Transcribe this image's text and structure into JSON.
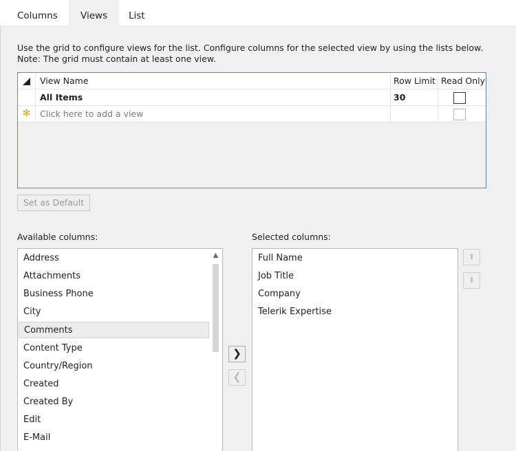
{
  "tabs": [
    {
      "label": "Columns",
      "active": false
    },
    {
      "label": "Views",
      "active": true
    },
    {
      "label": "List",
      "active": false
    }
  ],
  "description": {
    "line1": "Use the grid to configure views for the list. Configure columns for the selected view by using the lists below.",
    "line2": "Note: The grid must contain at least one view."
  },
  "grid": {
    "columns": {
      "view_name": "View Name",
      "row_limit": "Row Limit",
      "read_only": "Read Only"
    },
    "rows": [
      {
        "view_name": "All Items",
        "row_limit": "30",
        "read_only": false
      }
    ],
    "new_row_marker": "✻",
    "new_row_placeholder": "Click here to add a view"
  },
  "buttons": {
    "set_default": "Set as Default",
    "move_right": "❯",
    "move_left": "❮",
    "move_up": "⬆",
    "move_down": "⬇"
  },
  "available": {
    "label": "Available columns:",
    "items": [
      "Address",
      "Attachments",
      "Business Phone",
      "City",
      "Comments",
      "Content Type",
      "Country/Region",
      "Created",
      "Created By",
      "Edit",
      "E-Mail"
    ],
    "highlighted": "Comments"
  },
  "selected": {
    "label": "Selected columns:",
    "items": [
      "Full Name",
      "Job Title",
      "Company",
      "Telerik Expertise"
    ]
  },
  "icons": {
    "sort": "sort-triangle-icon",
    "scroll_up": "▲"
  },
  "colors": {
    "grid_border": "#5b87c5",
    "panel_bg": "#f0f0f0",
    "new_row_marker": "#e0a02a"
  }
}
